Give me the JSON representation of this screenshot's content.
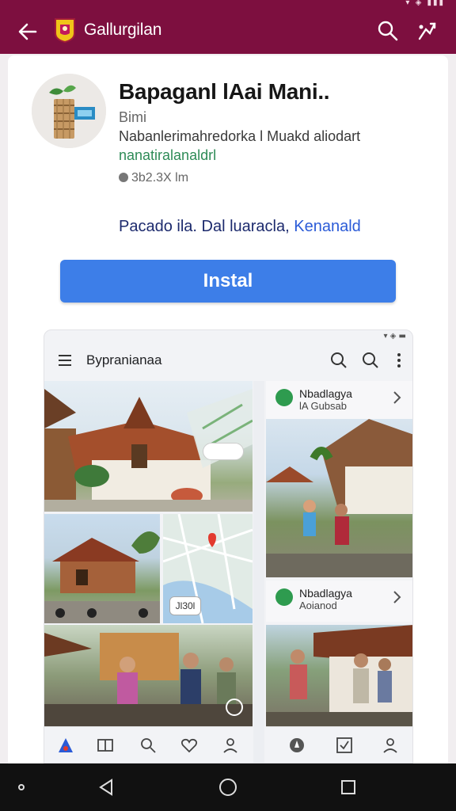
{
  "status_bar": {
    "icons": "▾ ◈ ▮▮▮"
  },
  "appbar": {
    "title": "Gallurgilan",
    "colors": {
      "bar": "#7d0f3f"
    }
  },
  "app": {
    "name": "Bapaganl lAai Mani..",
    "developer": "Bimi",
    "description_line1": "Nabanlerimahredorka l Muakd aliodart",
    "description_line2": "nanatiralanaldrl",
    "size": "3b2.3X lm",
    "location_prefix": "Pacado ila. Dal luaracla, ",
    "location_link": "Kenanald",
    "install_label": "Instal"
  },
  "preview": {
    "title": "Bypranianaa",
    "place_card_1": {
      "title": "Nbadlagya",
      "subtitle": "lA Gubsab"
    },
    "place_card_2": {
      "title": "Nbadlagya",
      "subtitle": "Aoianod"
    },
    "map_label": "Jl30l"
  },
  "colors": {
    "accent": "#3d7ee8",
    "brand": "#7d0f3f",
    "green": "#2e9b4f"
  }
}
